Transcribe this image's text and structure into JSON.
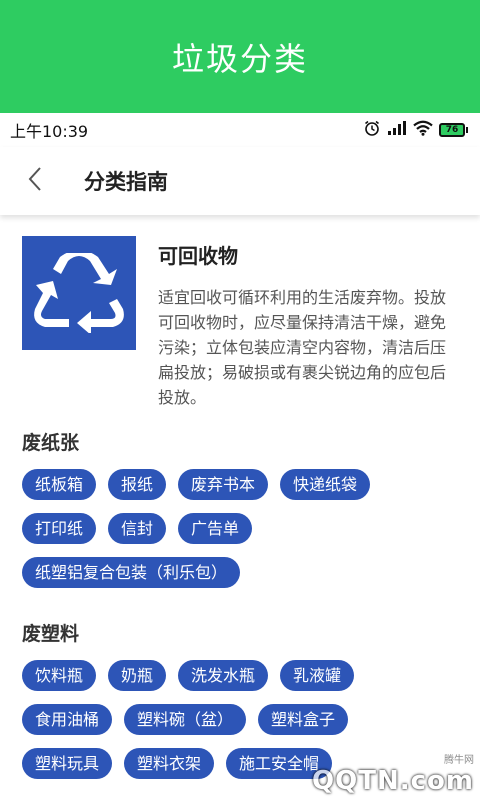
{
  "banner": {
    "title": "垃圾分类"
  },
  "status_bar": {
    "time": "上午10:39",
    "battery": "76"
  },
  "app_bar": {
    "back_icon": "chevron-left-icon",
    "title": "分类指南"
  },
  "category": {
    "icon": "recycle-icon",
    "title": "可回收物",
    "description": "适宜回收可循环利用的生活废弃物。投放可回收物时，应尽量保持清洁干燥，避免污染；立体包装应清空内容物，清洁后压扁投放；易破损或有裹尖锐边角的应包后投放。"
  },
  "sections": [
    {
      "title": "废纸张",
      "items": [
        "纸板箱",
        "报纸",
        "废弃书本",
        "快递纸袋",
        "打印纸",
        "信封",
        "广告单",
        "纸塑铝复合包装（利乐包）"
      ]
    },
    {
      "title": "废塑料",
      "items": [
        "饮料瓶",
        "奶瓶",
        "洗发水瓶",
        "乳液罐",
        "食用油桶",
        "塑料碗（盆）",
        "塑料盒子",
        "塑料玩具",
        "塑料衣架",
        "施工安全帽"
      ]
    }
  ],
  "watermark": {
    "small": "腾牛网",
    "big": "QQTN.com"
  },
  "colors": {
    "banner": "#2ecc61",
    "tag": "#2d55b7",
    "hero_icon_bg": "#2d55b7"
  }
}
